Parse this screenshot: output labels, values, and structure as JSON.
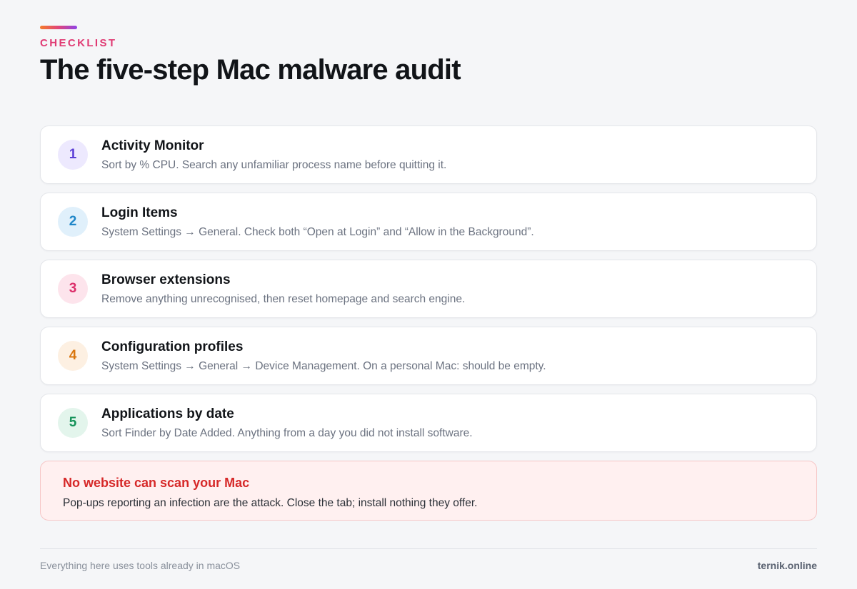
{
  "header": {
    "eyebrow": "CHECKLIST",
    "title": "The five-step Mac malware audit"
  },
  "steps": [
    {
      "number": "1",
      "title": "Activity Monitor",
      "description": "Sort by % CPU. Search any unfamiliar process name before quitting it.",
      "badge_bg": "#ede9fe",
      "badge_color": "#5b3fd6"
    },
    {
      "number": "2",
      "title": "Login Items",
      "description": "System Settings → General. Check both “Open at Login” and “Allow in the Background”.",
      "badge_bg": "#e0f0fb",
      "badge_color": "#1f86c8"
    },
    {
      "number": "3",
      "title": "Browser extensions",
      "description": "Remove anything unrecognised, then reset homepage and search engine.",
      "badge_bg": "#fde4ec",
      "badge_color": "#dc2e6a"
    },
    {
      "number": "4",
      "title": "Configuration profiles",
      "description": "System Settings → General → Device Management. On a personal Mac: should be empty.",
      "badge_bg": "#fdf0e2",
      "badge_color": "#d9760f"
    },
    {
      "number": "5",
      "title": "Applications by date",
      "description": "Sort Finder by Date Added. Anything from a day you did not install software.",
      "badge_bg": "#e3f5ec",
      "badge_color": "#16935a"
    }
  ],
  "warning": {
    "title": "No website can scan your Mac",
    "description": "Pop-ups reporting an infection are the attack. Close the tab; install nothing they offer."
  },
  "footer": {
    "note": "Everything here uses tools already in macOS",
    "brand": "ternik.online"
  }
}
